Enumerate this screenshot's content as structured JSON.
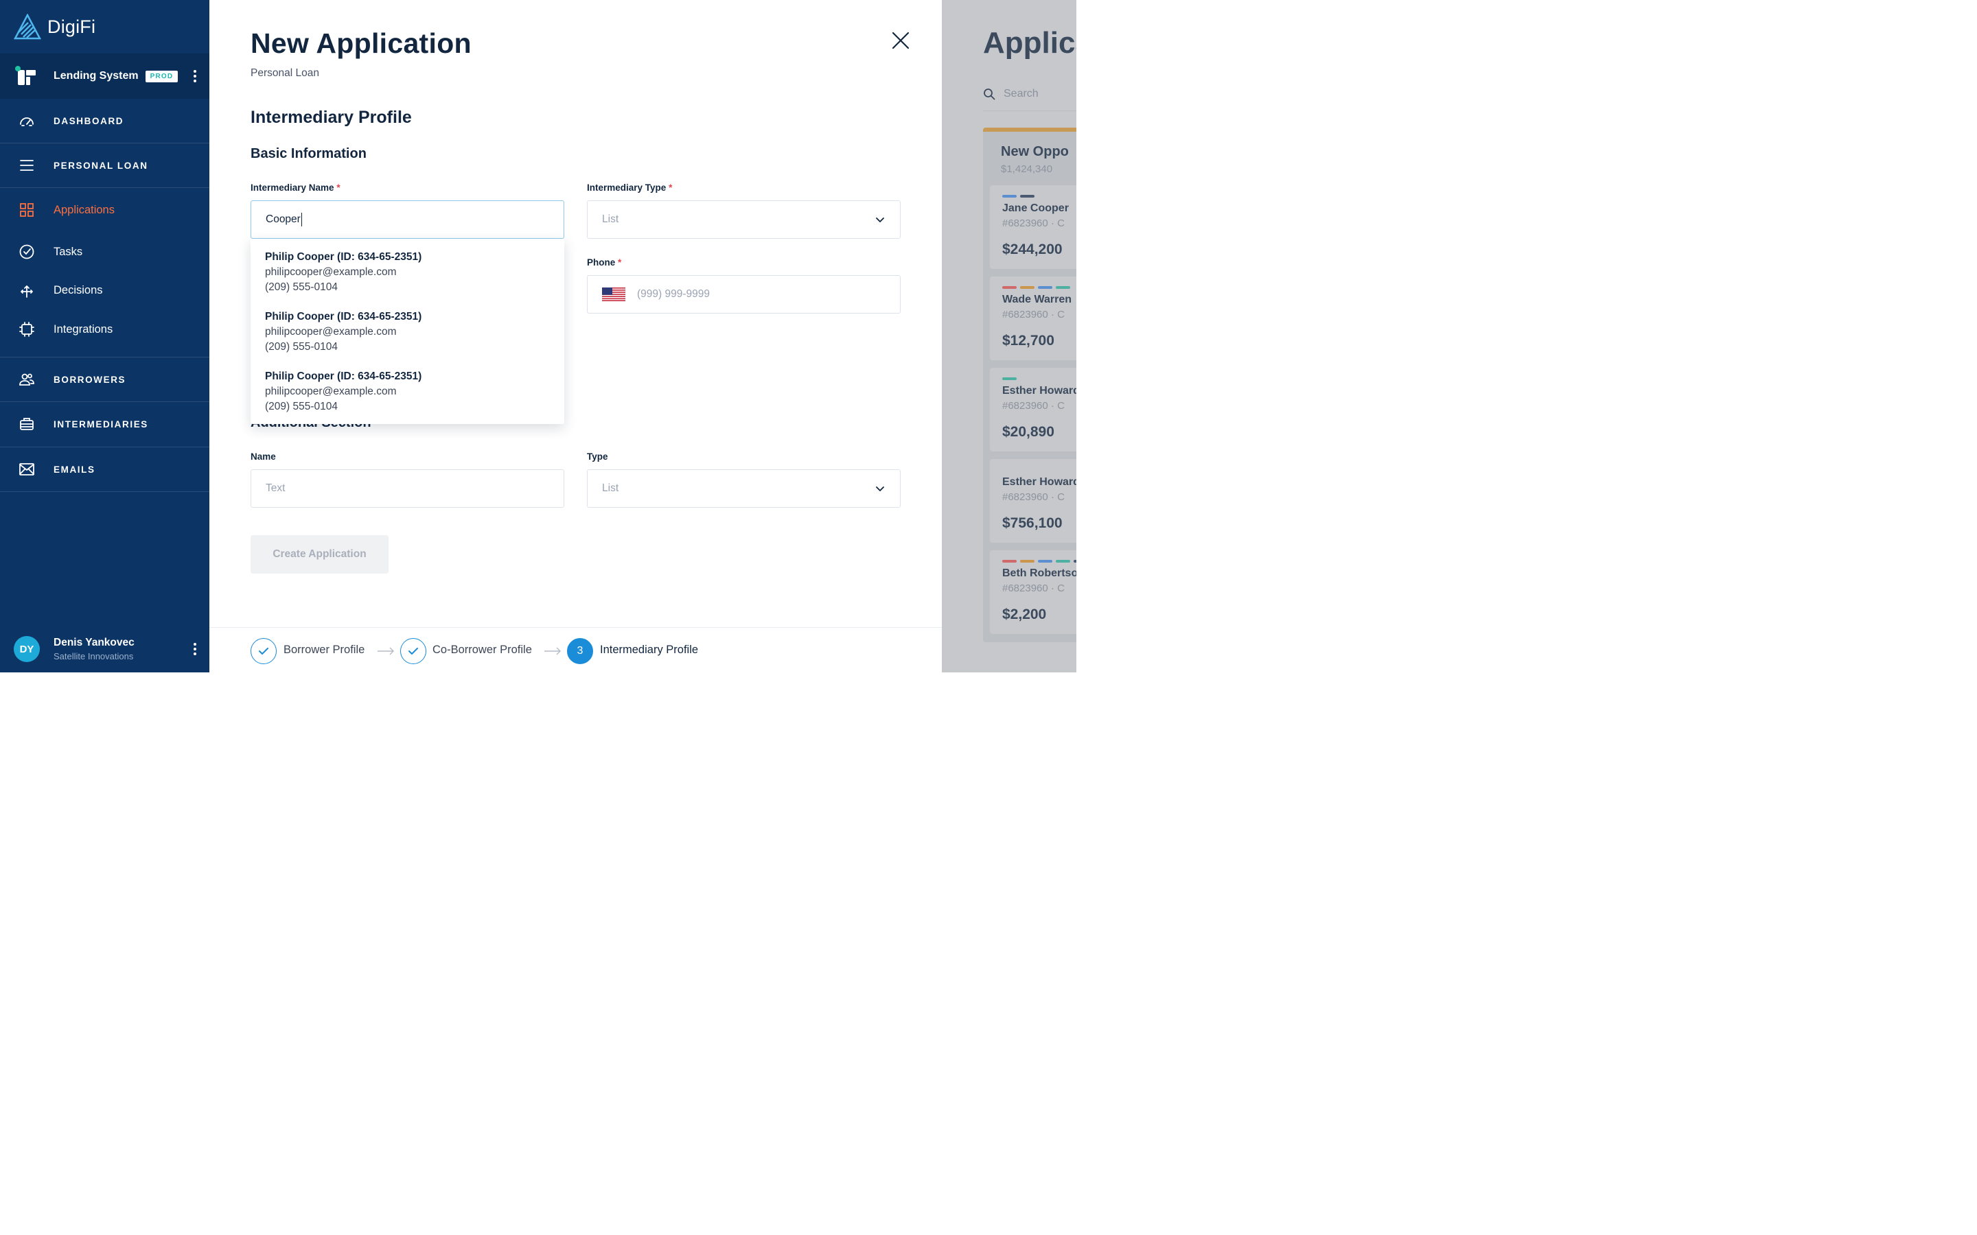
{
  "brand": {
    "name": "DigiFi"
  },
  "system": {
    "name": "Lending System",
    "badge": "PROD"
  },
  "nav": {
    "dashboard": "DASHBOARD",
    "personal_loan": "PERSONAL LOAN",
    "applications": "Applications",
    "tasks": "Tasks",
    "decisions": "Decisions",
    "integrations": "Integrations",
    "borrowers": "BORROWERS",
    "intermediaries": "INTERMEDIARIES",
    "emails": "EMAILS"
  },
  "user": {
    "initials": "DY",
    "name": "Denis Yankovec",
    "org": "Satellite Innovations"
  },
  "form": {
    "title": "New Application",
    "subtitle": "Personal Loan",
    "section": "Intermediary Profile",
    "subsection": "Basic Information",
    "intermediary_name_label": "Intermediary Name",
    "intermediary_name_value": "Cooper",
    "intermediary_type_label": "Intermediary Type",
    "intermediary_type_placeholder": "List",
    "phone_label": "Phone",
    "phone_placeholder": "(999) 999-9999",
    "additional_section": "Additional Section",
    "name_label": "Name",
    "name_placeholder": "Text",
    "type_label": "Type",
    "type_placeholder": "List",
    "create_button": "Create Application",
    "required_mark": "*"
  },
  "suggestions": [
    {
      "name": "Philip Cooper (ID: 634-65-2351)",
      "email": "philipcooper@example.com",
      "phone": "(209) 555-0104"
    },
    {
      "name": "Philip Cooper (ID: 634-65-2351)",
      "email": "philipcooper@example.com",
      "phone": "(209) 555-0104"
    },
    {
      "name": "Philip Cooper (ID: 634-65-2351)",
      "email": "philipcooper@example.com",
      "phone": "(209) 555-0104"
    }
  ],
  "steps": [
    {
      "label": "Borrower Profile",
      "state": "done"
    },
    {
      "label": "Co-Borrower Profile",
      "state": "done"
    },
    {
      "label": "Intermediary Profile",
      "state": "current",
      "number": "3"
    }
  ],
  "background": {
    "title": "Applica",
    "search_placeholder": "Search",
    "column_title": "New Oppo",
    "column_sum": "$1,424,340",
    "cards": [
      {
        "name": "Jane Cooper",
        "id": "#6823960 · C",
        "amount": "$244,200",
        "tags": [
          "#5b8fd0",
          "#4a5a72"
        ]
      },
      {
        "name": "Wade Warren",
        "id": "#6823960 · C",
        "amount": "$12,700",
        "tags": [
          "#d06a6a",
          "#c9964c",
          "#5b8fd0",
          "#4db0a0"
        ]
      },
      {
        "name": "Esther Howard",
        "id": "#6823960 · C",
        "amount": "$20,890",
        "tags": [
          "#4db0a0"
        ]
      },
      {
        "name": "Esther Howard",
        "id": "#6823960 · C",
        "amount": "$756,100",
        "tags": []
      },
      {
        "name": "Beth Robertson",
        "id": "#6823960 · C",
        "amount": "$2,200",
        "tags": [
          "#d06a6a",
          "#c9964c",
          "#5b8fd0",
          "#4db0a0",
          "#4a5a72"
        ]
      }
    ]
  }
}
